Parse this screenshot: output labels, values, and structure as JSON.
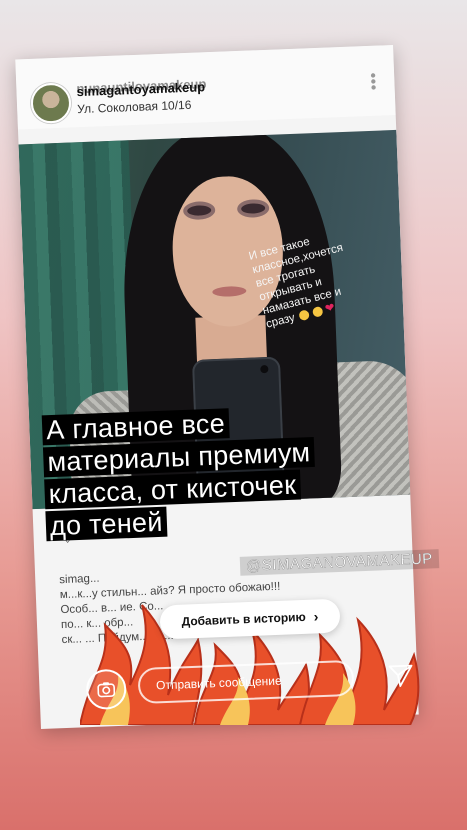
{
  "header": {
    "username": "simagantoyamakeup",
    "username_overlay": "nunauntilovamakeup",
    "location": "Ул. Соколовая 10/16"
  },
  "handwriting": {
    "lines": [
      "И все такое",
      "классное,хочется",
      "все трогать",
      "открывать и",
      "намазать все и",
      "сразу"
    ]
  },
  "overlay_text": {
    "line1": "А главное  все",
    "line2": "материалы премиум",
    "line3": "класса, от кисточек",
    "line4": "до теней"
  },
  "mention": "@SIMAGANOVAMAKEUP",
  "caption": {
    "line1": "simag...                                        ",
    "line2": "м...к...у стильн...          айз? Я просто обожаю!!!",
    "line3": "Особ...   в...                       ие. Со...",
    "line4": "по...    к...                          обр...",
    "line5": "ск...    ...          Пойдум...   се..."
  },
  "add_story_button": "Добавить в историю",
  "message_placeholder": "Отправить сообщение",
  "icons": {
    "more": "more-vertical-icon",
    "like": "heart-icon",
    "camera": "camera-icon",
    "send": "send-icon",
    "chevron": "chevron-right-icon"
  },
  "colors": {
    "background_top": "#e9e6e8",
    "background_bottom": "#d9706b",
    "overlay_bg": "#000000",
    "fire_outer": "#e8502a",
    "fire_inner": "#f7c45a"
  }
}
